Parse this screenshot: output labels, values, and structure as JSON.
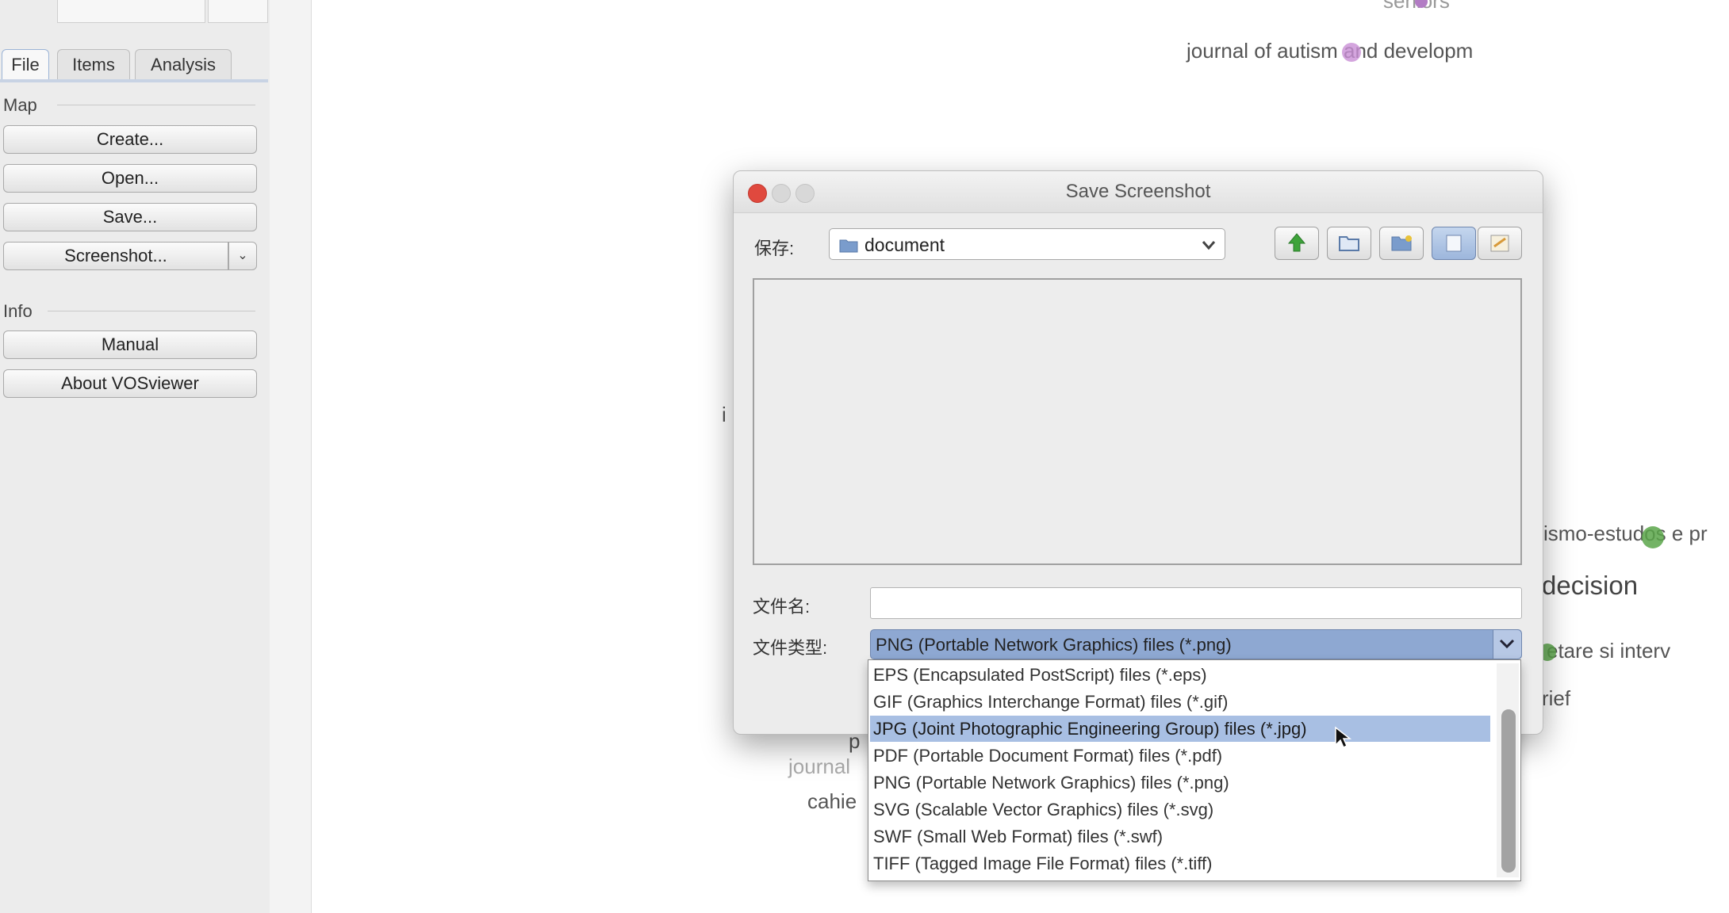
{
  "left_panel": {
    "tabs": [
      {
        "label": "File",
        "active": true
      },
      {
        "label": "Items",
        "active": false
      },
      {
        "label": "Analysis",
        "active": false
      }
    ],
    "map_section": {
      "title": "Map",
      "buttons": [
        "Create...",
        "Open...",
        "Save...",
        "Screenshot..."
      ]
    },
    "info_section": {
      "title": "Info",
      "buttons": [
        "Manual",
        "About VOSviewer"
      ]
    }
  },
  "map_labels": {
    "top": "seniors",
    "journal_autism": "journal of autism and developm",
    "letter_i": "i",
    "ismo": "ismo-estudos e pr",
    "decision": "decision",
    "etare": "etare si interv",
    "brief": "rief",
    "p": "p",
    "journal_partial": "journal",
    "cahie": "cahie"
  },
  "dialog": {
    "title": "Save Screenshot",
    "location_label": "保存:",
    "location_value": "document",
    "filename_label": "文件名:",
    "filename_value": "",
    "filetype_label": "文件类型:",
    "filetype_value": "PNG (Portable Network Graphics) files (*.png)"
  },
  "filetype_options": [
    "EPS (Encapsulated PostScript) files (*.eps)",
    "GIF (Graphics Interchange Format) files (*.gif)",
    "JPG (Joint Photographic Engineering Group) files (*.jpg)",
    "PDF (Portable Document Format) files (*.pdf)",
    "PNG (Portable Network Graphics) files (*.png)",
    "SVG (Scalable Vector Graphics) files (*.svg)",
    "SWF (Small Web Format) files (*.swf)",
    "TIFF (Tagged Image File Format) files (*.tiff)"
  ],
  "highlighted_option_index": 2,
  "colors": {
    "selection": "#a8bfe3",
    "combo_selected": "#8ea8d2",
    "close_button": "#e0493e",
    "green_node": "#5aa64a",
    "purple_node": "#c98fd6"
  }
}
